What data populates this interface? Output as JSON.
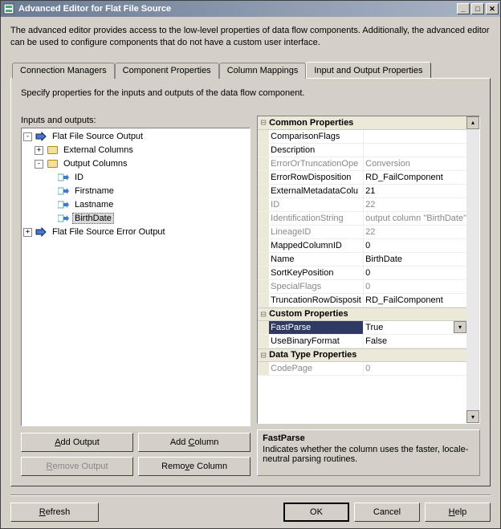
{
  "window": {
    "title": "Advanced Editor for Flat File Source"
  },
  "description": "The advanced editor provides access to the low-level properties of data flow components.  Additionally, the advanced editor can be used to configure components that do not have a custom user interface.",
  "tabs": {
    "t0": "Connection Managers",
    "t1": "Component Properties",
    "t2": "Column Mappings",
    "t3": "Input and Output Properties"
  },
  "panel": {
    "subtitle": "Specify properties for the inputs and outputs of the data flow component.",
    "treelabel": "Inputs and outputs:"
  },
  "tree": {
    "root": "Flat File Source Output",
    "external": "External Columns",
    "outputcols": "Output Columns",
    "c0": "ID",
    "c1": "Firstname",
    "c2": "Lastname",
    "c3": "BirthDate",
    "erroroutput": "Flat File Source Error Output"
  },
  "buttons": {
    "add_output": "Add Output",
    "add_column": "Add Column",
    "remove_output": "Remove Output",
    "remove_column": "Remove Column",
    "refresh": "Refresh",
    "ok": "OK",
    "cancel": "Cancel",
    "help": "Help"
  },
  "propcats": {
    "common": "Common Properties",
    "custom": "Custom Properties",
    "datatype": "Data Type Properties"
  },
  "props": {
    "ComparisonFlags": {
      "name": "ComparisonFlags",
      "value": ""
    },
    "Description": {
      "name": "Description",
      "value": ""
    },
    "ErrorOrTruncationOperation": {
      "name": "ErrorOrTruncationOpe",
      "value": "Conversion"
    },
    "ErrorRowDisposition": {
      "name": "ErrorRowDisposition",
      "value": "RD_FailComponent"
    },
    "ExternalMetadataColumnID": {
      "name": "ExternalMetadataColu",
      "value": "21"
    },
    "ID": {
      "name": "ID",
      "value": "22"
    },
    "IdentificationString": {
      "name": "IdentificationString",
      "value": "output column \"BirthDate\""
    },
    "LineageID": {
      "name": "LineageID",
      "value": "22"
    },
    "MappedColumnID": {
      "name": "MappedColumnID",
      "value": "0"
    },
    "Name": {
      "name": "Name",
      "value": "BirthDate"
    },
    "SortKeyPosition": {
      "name": "SortKeyPosition",
      "value": "0"
    },
    "SpecialFlags": {
      "name": "SpecialFlags",
      "value": "0"
    },
    "TruncationRowDisposition": {
      "name": "TruncationRowDisposit",
      "value": "RD_FailComponent"
    },
    "FastParse": {
      "name": "FastParse",
      "value": "True"
    },
    "UseBinaryFormat": {
      "name": "UseBinaryFormat",
      "value": "False"
    },
    "CodePage": {
      "name": "CodePage",
      "value": "0"
    }
  },
  "help": {
    "title": "FastParse",
    "text": "Indicates whether the column uses the faster, locale-neutral parsing routines."
  }
}
